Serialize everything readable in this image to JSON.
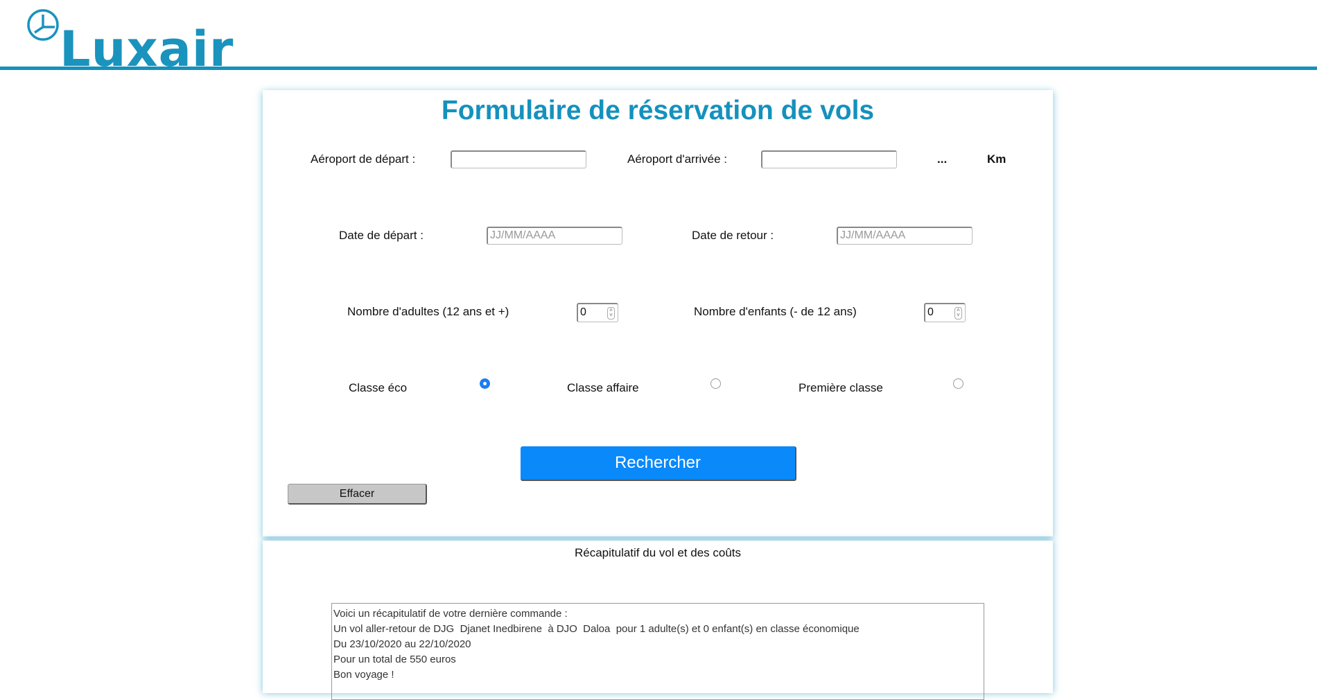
{
  "header": {
    "logo_text": "Luxair"
  },
  "form": {
    "title": "Formulaire de réservation de vols",
    "departure_airport_label": "Aéroport de départ :",
    "departure_airport_value": "",
    "arrival_airport_label": "Aéroport d'arrivée :",
    "arrival_airport_value": "",
    "distance_value": "...",
    "distance_unit": "Km",
    "departure_date_label": "Date de départ :",
    "departure_date_placeholder": "JJ/MM/AAAA",
    "return_date_label": "Date de retour :",
    "return_date_placeholder": "JJ/MM/AAAA",
    "adults_label": "Nombre d'adultes (12 ans et +)",
    "adults_value": "0",
    "children_label": "Nombre d'enfants (- de 12 ans)",
    "children_value": "0",
    "class_eco_label": "Classe éco",
    "class_business_label": "Classe affaire",
    "class_first_label": "Première classe",
    "selected_class": "eco",
    "search_button": "Rechercher",
    "clear_button": "Effacer"
  },
  "summary": {
    "title": "Récapitulatif du vol et des coûts",
    "lines": [
      "Voici un récapitulatif de votre dernière commande :",
      "Un vol aller-retour de DJG  Djanet Inedbirene  à DJO  Daloa  pour 1 adulte(s) et 0 enfant(s) en classe économique",
      "Du 23/10/2020 au 22/10/2020",
      "Pour un total de 550 euros",
      "",
      "Bon voyage !"
    ]
  },
  "colors": {
    "brand": "#1591bd",
    "button_primary": "#0a89fb",
    "button_secondary": "#c7c7c7"
  }
}
